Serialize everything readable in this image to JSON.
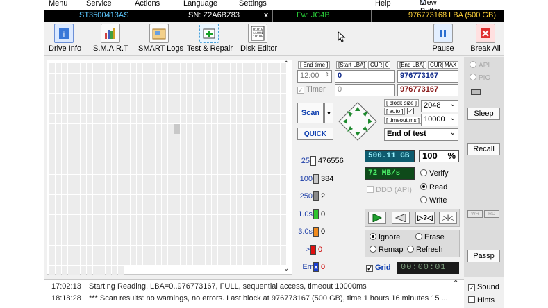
{
  "menu": {
    "items": [
      "Menu",
      "Service",
      "Actions",
      "Language",
      "Settings",
      "Help"
    ],
    "view_buffer": "View Buffer Live"
  },
  "infobar": {
    "model": "ST3500413AS",
    "serial": "SN: Z2A6BZ83",
    "close": "x",
    "firmware": "Fw: JC4B",
    "capacity": "976773168 LBA (500 GB)"
  },
  "toolbar": {
    "drive_info": "Drive Info",
    "smart": "S.M.A.R.T",
    "smart_logs": "SMART Logs",
    "test_repair": "Test & Repair",
    "disk_editor": "Disk Editor",
    "pause": "Pause",
    "break_all": "Break All"
  },
  "scan_params": {
    "end_time_label": "[ End time ]",
    "end_time_value": "12:00",
    "start_lba_label": "[Start LBA]",
    "cur_label": "CUR",
    "start_cur_value": "0",
    "start_lba_value": "0",
    "end_lba_label": "[End LBA]",
    "max_label": "MAX",
    "end_lba_value": "976773167",
    "timer_label": "Timer",
    "timer_value": "0",
    "end_lba_value2": "976773167",
    "scan_button": "Scan",
    "quick_button": "QUICK",
    "block_size_label": "[ block size ]",
    "auto_label": "[ auto ]",
    "block_size_value": "2048",
    "timeout_label": "[ timeout,ms ]",
    "timeout_value": "10000",
    "end_action": "End of test"
  },
  "right_panel": {
    "api": "API",
    "pio": "PIO",
    "sleep": "Sleep",
    "recall": "Recall",
    "wr": "WR",
    "rd": "RD",
    "passp": "Passp"
  },
  "stats": [
    {
      "label": "25",
      "count": "476556",
      "color": "#ffffff"
    },
    {
      "label": "100",
      "count": "384",
      "color": "#c8c8c8"
    },
    {
      "label": "250",
      "count": "2",
      "color": "#8a8a8a"
    },
    {
      "label": "1.0s",
      "count": "0",
      "color": "#2ec42e"
    },
    {
      "label": "3.0s",
      "count": "0",
      "color": "#f08a1e"
    },
    {
      "label": ">",
      "count": "0",
      "color": "#e01010"
    },
    {
      "label": "Err",
      "count": "0",
      "color": "#1a3fd0",
      "mark": "x"
    }
  ],
  "status": {
    "size": "500.11 GB",
    "percent": "100",
    "percent_sign": "%",
    "speed": "72 MB/s",
    "verify": "Verify",
    "read": "Read",
    "write": "Write",
    "ddd": "DDD (API)",
    "ignore": "Ignore",
    "erase": "Erase",
    "remap": "Remap",
    "refresh": "Refresh",
    "grid": "Grid",
    "elapsed": "00:00:01"
  },
  "log": {
    "lines": [
      {
        "time": "17:02:13",
        "text": "Starting Reading, LBA=0..976773167, FULL, sequential access, timeout 10000ms"
      },
      {
        "time": "18:18:28",
        "text": "*** Scan results: no warnings, no errors. Last block at 976773167 (500 GB), time 1 hours 16 minutes 15 ..."
      }
    ],
    "sound": "Sound",
    "hints": "Hints"
  },
  "colors": {
    "title_blue": "#2b7bd1",
    "model": "#5cc8ff",
    "firmware": "#2ad23a",
    "capacity": "#ffd23a",
    "lcd_bg": "#0e5b6e",
    "lcd_text": "#9df2ff"
  }
}
